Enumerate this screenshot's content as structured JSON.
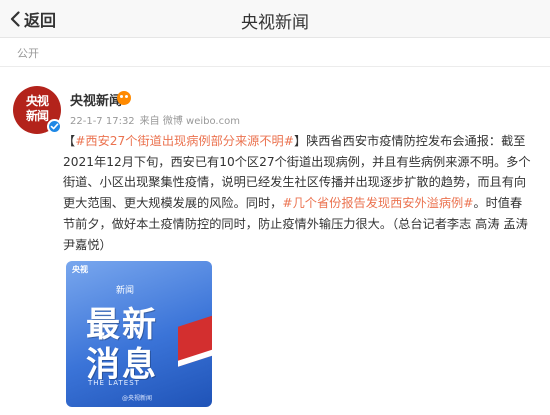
{
  "header": {
    "back_label": "返回",
    "title": "央视新闻"
  },
  "visibility": "公开",
  "author": {
    "name": "央视新闻",
    "avatar_text_line1": "央视",
    "avatar_text_line2": "新闻"
  },
  "meta": {
    "time": "22-1-7 17:32",
    "source": "来自 微博 weibo.com"
  },
  "post": {
    "topic1": "#西安27个街道出现病例部分来源不明#",
    "text1": "陕西省西安市疫情防控发布会通报：截至2021年12月下旬，西安已有10个区27个街道出现病例，并且有些病例来源不明。多个街道、小区出现聚集性疫情，说明已经发生社区传播并出现逐步扩散的趋势，而且有向更大范围、更大规模发展的风险。同时，",
    "topic2": "#几个省份报告发现西安外溢病例#",
    "text2": "。时值春节前夕，做好本土疫情防控的同时，防止疫情外输压力很大。（总台记者李志 高涛 孟涛 尹嘉悦）"
  },
  "image": {
    "logo": "央视",
    "brand": "新闻",
    "line1": "最新",
    "line2": "消息",
    "subtitle": "THE LATEST",
    "watermark": "@央视新闻"
  },
  "colors": {
    "accent": "#eb7350",
    "avatar": "#b3231b",
    "verify": "#1e88e5",
    "vip": "#ff8a00"
  },
  "icons": {
    "back": "chevron-left-icon",
    "verify": "verified-badge-icon",
    "vip": "vip-badge-icon"
  }
}
